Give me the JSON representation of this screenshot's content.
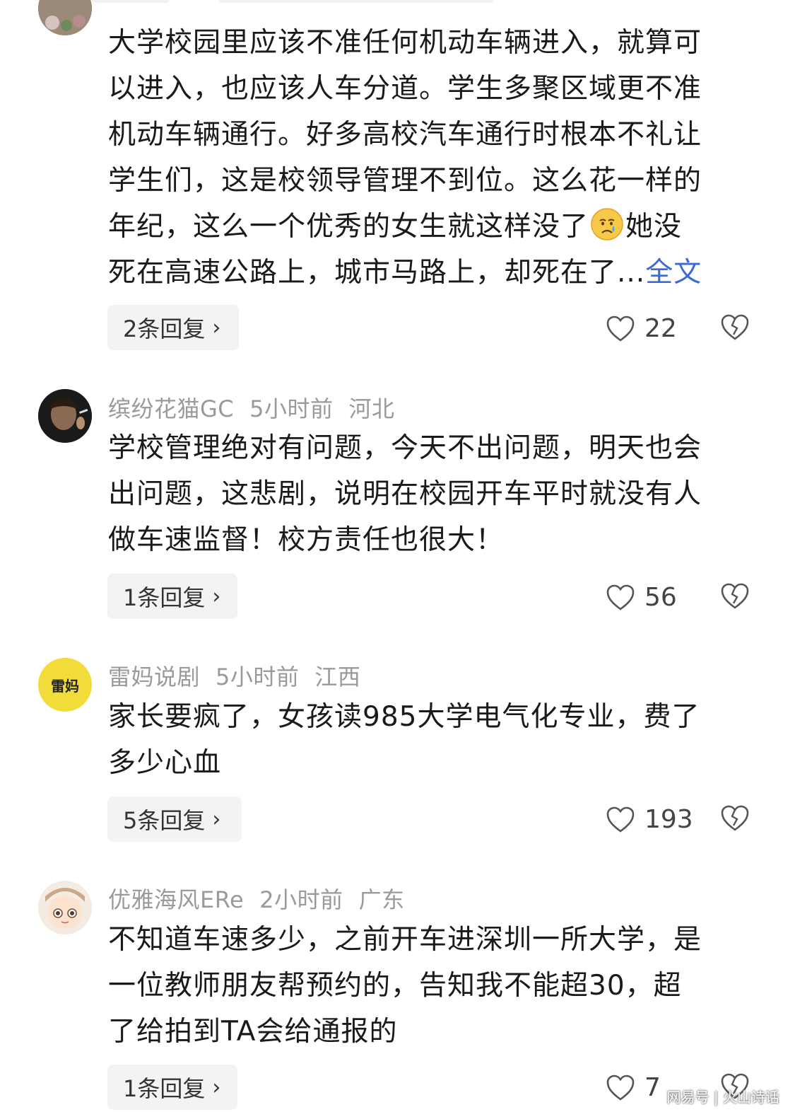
{
  "comments": [
    {
      "lines": [
        "大学校园里应该不准任何机动车辆进入，就算可",
        "以进入，也应该人车分道。学生多聚区域更不准",
        "机动车辆通行。好多高校汽车通行时根本不礼让",
        "学生们，这是校领导管理不到位。这么花一样的"
      ],
      "line5_before": "年纪，这么一个优秀的女生就这样没了",
      "line5_after": "她没",
      "line6": "死在高速公路上，城市马路上，却死在了...",
      "full_text_link": "全文",
      "reply_label": "2条回复",
      "likes": "22"
    },
    {
      "username": "缤纷花猫GC",
      "time": "5小时前",
      "location": "河北",
      "lines": [
        "学校管理绝对有问题，今天不出问题，明天也会",
        "出问题，这悲剧，说明在校园开车平时就没有人",
        "做车速监督！校方责任也很大！"
      ],
      "reply_label": "1条回复",
      "likes": "56"
    },
    {
      "username": "雷妈说剧",
      "avatar_text": "雷妈",
      "time": "5小时前",
      "location": "江西",
      "lines": [
        "家长要疯了，女孩读985大学电气化专业，费了",
        "多少心血"
      ],
      "reply_label": "5条回复",
      "likes": "193"
    },
    {
      "username": "优雅海风ERe",
      "time": "2小时前",
      "location": "广东",
      "lines": [
        "不知道车速多少，之前开车进深圳一所大学，是",
        "一位教师朋友帮预约的，告知我不能超30，超",
        "了给拍到TA会给通报的"
      ],
      "reply_label": "1条回复",
      "likes": "7"
    }
  ],
  "icons": {
    "like": "heart-outline-icon",
    "dislike": "broken-heart-icon",
    "chevron": "chevron-right-icon",
    "emoji": "crying-face-emoji"
  },
  "colors": {
    "link": "#3a6bd6",
    "meta": "#9a9a9a",
    "reply_bg": "#f3f3f3",
    "avatar3_bg": "#f2dc3a"
  },
  "watermark": "网易号 | 火山诗话"
}
